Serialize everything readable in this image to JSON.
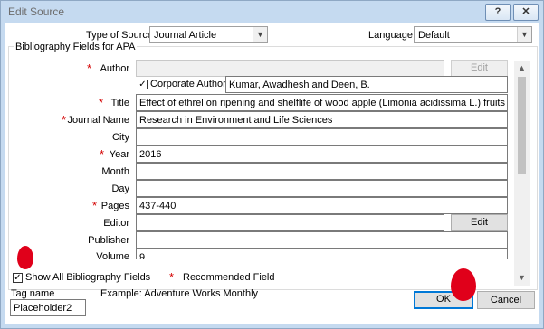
{
  "window": {
    "title": "Edit Source",
    "help_glyph": "?",
    "close_glyph": "✕"
  },
  "type_of_source": {
    "label": "Type of Source",
    "value": "Journal Article"
  },
  "language": {
    "label": "Language",
    "value": "Default"
  },
  "group_title": "Bibliography Fields for APA",
  "corporate_author": {
    "label": "Corporate Author",
    "checked": true,
    "value": "Kumar, Awadhesh and Deen, B."
  },
  "fields": {
    "author": {
      "label": "Author",
      "value": "",
      "required": true,
      "button": "Edit"
    },
    "title": {
      "label": "Title",
      "value": "Effect of ethrel on ripening and shelflife of wood apple (Limonia acidissima L.) fruits",
      "required": true
    },
    "journal_name": {
      "label": "Journal Name",
      "value": "Research in Environment and Life Sciences",
      "required": true
    },
    "city": {
      "label": "City",
      "value": "",
      "required": false
    },
    "year": {
      "label": "Year",
      "value": "2016",
      "required": true
    },
    "month": {
      "label": "Month",
      "value": "",
      "required": false
    },
    "day": {
      "label": "Day",
      "value": "",
      "required": false
    },
    "pages": {
      "label": "Pages",
      "value": "437-440",
      "required": true
    },
    "editor": {
      "label": "Editor",
      "value": "",
      "required": false,
      "button": "Edit"
    },
    "publisher": {
      "label": "Publisher",
      "value": "",
      "required": false
    },
    "volume": {
      "label": "Volume",
      "value": "9",
      "required": false
    }
  },
  "required_star": "*",
  "show_all": {
    "label": "Show All Bibliography Fields",
    "checked": true
  },
  "legend_recommended": "Recommended Field",
  "tag": {
    "label": "Tag name",
    "value": "Placeholder2",
    "example": "Example: Adventure Works Monthly"
  },
  "buttons": {
    "ok": "OK",
    "cancel": "Cancel"
  },
  "accent_colors": {
    "annotation": "#e0001a",
    "focus": "#0078d7",
    "star": "#d40000"
  }
}
